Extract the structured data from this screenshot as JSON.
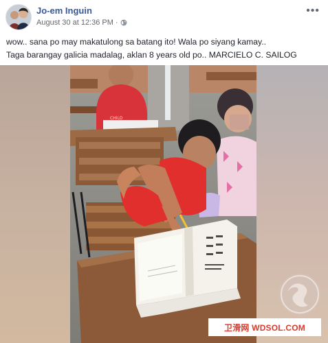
{
  "post": {
    "author": "Jo-em Inguin",
    "timestamp": "August 30 at 12:36 PM",
    "separator": "·",
    "privacy_icon": "globe-icon",
    "menu_label": "•••",
    "text_lines": [
      "wow.. sana po may makatulong sa batang ito! Wala po siyang kamay..",
      "Taga barangay galicia madalag, aklan 8 years old po.. MARCIELO C. SAILOG"
    ]
  },
  "photo": {
    "shirt_print": "CHILD"
  },
  "watermark": {
    "text": "卫滑网 WDSOL.COM"
  },
  "colors": {
    "author_link": "#385898",
    "watermark_text": "#d93a2b"
  }
}
